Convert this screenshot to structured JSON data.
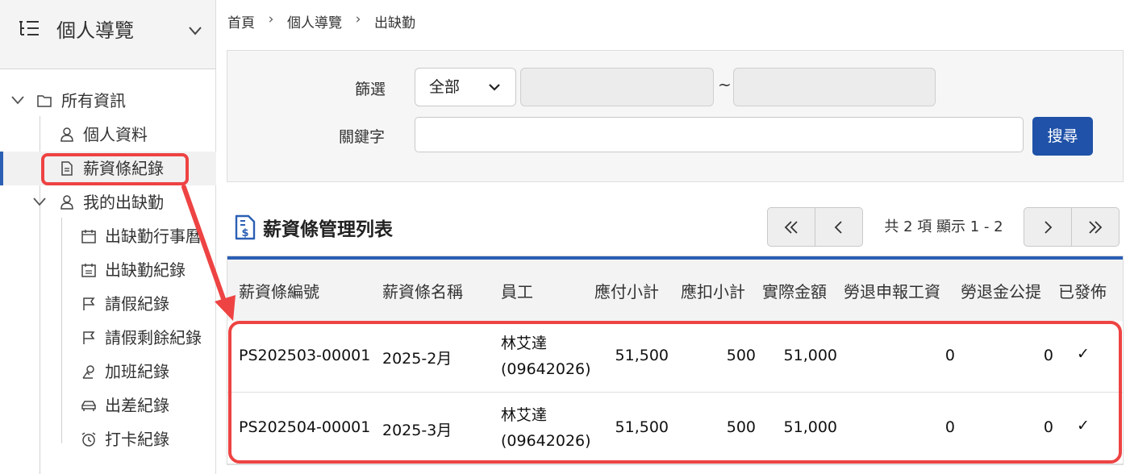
{
  "sidebar": {
    "title": "個人導覽",
    "menu_icon": "list-tree-icon",
    "items": [
      {
        "label": "所有資訊",
        "icon": "folder-icon"
      },
      {
        "label": "個人資料",
        "icon": "user-icon"
      },
      {
        "label": "薪資條紀錄",
        "icon": "document-icon"
      },
      {
        "label": "我的出缺勤",
        "icon": "user-icon"
      },
      {
        "label": "出缺勤行事曆",
        "icon": "calendar-icon"
      },
      {
        "label": "出缺勤紀錄",
        "icon": "calendar-list-icon"
      },
      {
        "label": "請假紀錄",
        "icon": "flag-icon"
      },
      {
        "label": "請假剩餘紀錄",
        "icon": "flag-icon"
      },
      {
        "label": "加班紀錄",
        "icon": "overtime-icon"
      },
      {
        "label": "出差紀錄",
        "icon": "car-icon"
      },
      {
        "label": "打卡紀錄",
        "icon": "alarm-clock-icon"
      }
    ]
  },
  "breadcrumb": [
    "首頁",
    "個人導覽",
    "出缺勤"
  ],
  "filter": {
    "filter_label": "篩選",
    "select_value": "全部",
    "tilde": "~",
    "keyword_label": "關鍵字",
    "search_label": "搜尋"
  },
  "list": {
    "title": "薪資條管理列表",
    "pager_info": "共 2 項 顯示 1 - 2"
  },
  "table": {
    "headers": [
      "薪資條編號",
      "薪資條名稱",
      "員工",
      "應付小計",
      "應扣小計",
      "實際金額",
      "勞退申報工資",
      "勞退金公提",
      "已發佈"
    ],
    "rows": [
      {
        "id": "PS202503-00001",
        "name": "2025-2月",
        "emp_name": "林艾達",
        "emp_id": "(09642026)",
        "payable": "51,500",
        "deduct": "500",
        "actual": "51,000",
        "pension_wage": "0",
        "pension": "0",
        "published": "✓"
      },
      {
        "id": "PS202504-00001",
        "name": "2025-3月",
        "emp_name": "林艾達",
        "emp_id": "(09642026)",
        "payable": "51,500",
        "deduct": "500",
        "actual": "51,000",
        "pension_wage": "0",
        "pension": "0",
        "published": "✓"
      }
    ]
  },
  "colors": {
    "accent": "#2b5fb4",
    "button": "#1f52a8",
    "annotation": "#ee4343"
  }
}
